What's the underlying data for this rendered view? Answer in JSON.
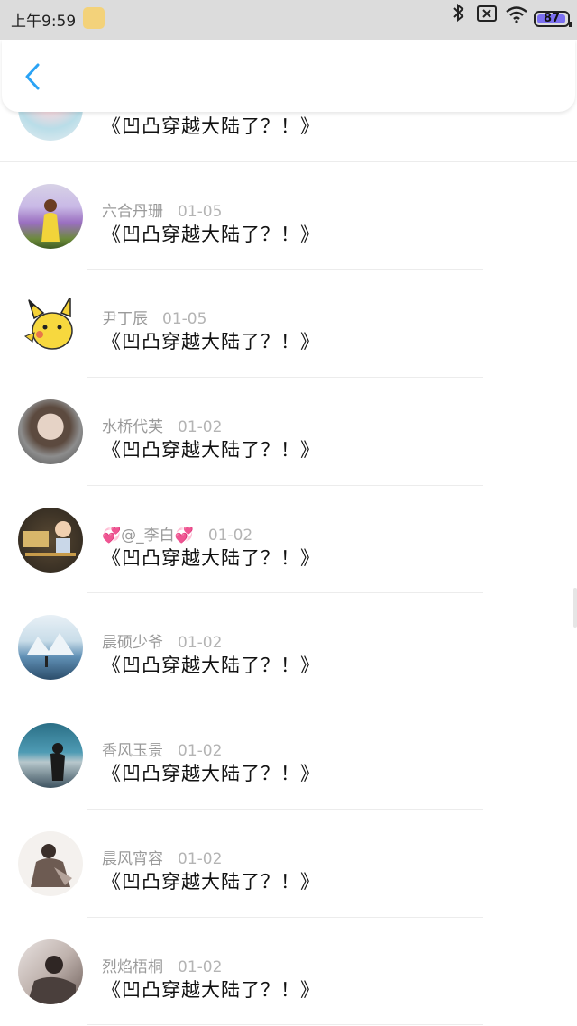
{
  "status_bar": {
    "time": "上午9:59",
    "battery": "87",
    "icons": [
      "bluetooth-icon",
      "sim-x-icon",
      "wifi-icon",
      "battery-icon"
    ]
  },
  "nav": {
    "back_icon": "chevron-left-icon"
  },
  "colors": {
    "accent": "#2aa3f5",
    "status_bar": "#dcdcdc"
  },
  "items": [
    {
      "name": "",
      "date": "",
      "title": "《凹凸穿越大陆了？！》"
    },
    {
      "name": "六合丹珊",
      "date": "01-05",
      "title": "《凹凸穿越大陆了？！》"
    },
    {
      "name": "尹丁辰",
      "date": "01-05",
      "title": "《凹凸穿越大陆了？！》"
    },
    {
      "name": "水桥代芙",
      "date": "01-02",
      "title": "《凹凸穿越大陆了？！》"
    },
    {
      "name": "💞@_李白💞",
      "date": "01-02",
      "title": "《凹凸穿越大陆了？！》"
    },
    {
      "name": "晨硕少爷",
      "date": "01-02",
      "title": "《凹凸穿越大陆了？！》"
    },
    {
      "name": "香风玉景",
      "date": "01-02",
      "title": "《凹凸穿越大陆了？！》"
    },
    {
      "name": "晨风宵容",
      "date": "01-02",
      "title": "《凹凸穿越大陆了？！》"
    },
    {
      "name": "烈焰梧桐",
      "date": "01-02",
      "title": "《凹凸穿越大陆了？！》"
    }
  ]
}
